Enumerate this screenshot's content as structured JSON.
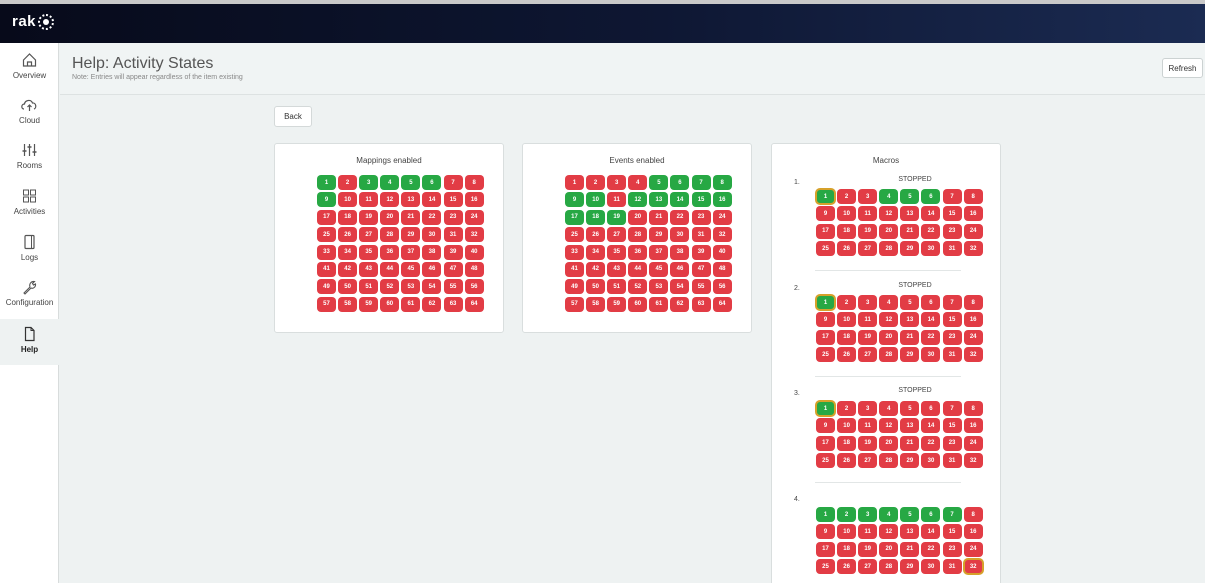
{
  "app": {
    "logo_text": "rak"
  },
  "nav": [
    {
      "label": "Overview",
      "icon": "home-icon"
    },
    {
      "label": "Cloud",
      "icon": "cloud-upload-icon"
    },
    {
      "label": "Rooms",
      "icon": "sliders-icon"
    },
    {
      "label": "Activities",
      "icon": "grid-icon"
    },
    {
      "label": "Logs",
      "icon": "panel-icon"
    },
    {
      "label": "Configuration",
      "icon": "wrench-icon"
    },
    {
      "label": "Help",
      "icon": "document-icon"
    }
  ],
  "header": {
    "title": "Help: Activity States",
    "note": "Note: Entries will appear regardless of the item existing",
    "refresh_label": "Refresh"
  },
  "back_label": "Back",
  "colors": {
    "enabled": "#27a844",
    "disabled": "#e23c45",
    "current": "#d6a12a"
  },
  "mappings": {
    "title": "Mappings enabled",
    "count": 64,
    "enabled": [
      1,
      3,
      4,
      5,
      6,
      9
    ]
  },
  "events": {
    "title": "Events enabled",
    "count": 64,
    "enabled": [
      5,
      6,
      7,
      8,
      9,
      10,
      12,
      13,
      14,
      15,
      16,
      17,
      18,
      19
    ]
  },
  "macros": {
    "title": "Macros",
    "items": [
      {
        "number": "1.",
        "status": "STOPPED",
        "enabled": [
          1,
          4,
          5,
          6
        ],
        "current": 1
      },
      {
        "number": "2.",
        "status": "STOPPED",
        "enabled": [
          1
        ],
        "current": 1
      },
      {
        "number": "3.",
        "status": "STOPPED",
        "enabled": [
          1
        ],
        "current": 1
      },
      {
        "number": "4.",
        "status": "",
        "enabled": [
          1,
          2,
          3,
          4,
          5,
          6,
          7
        ],
        "current": 32
      }
    ]
  }
}
